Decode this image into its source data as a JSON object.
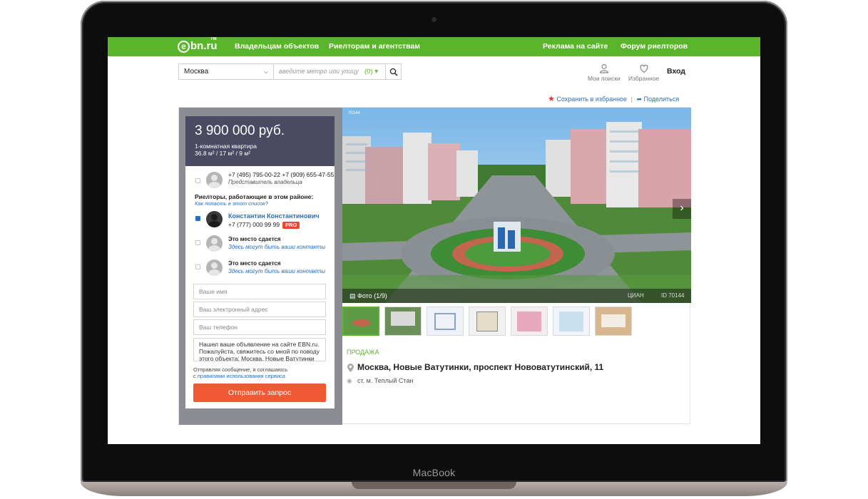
{
  "device": {
    "brand": "MacBook"
  },
  "nav": {
    "logo_text": "bn.ru",
    "logo_letter": "e",
    "logo_tm": "TM",
    "links": [
      "Владельцам объектов",
      "Риелторам и агентствам",
      "Реклама на сайте",
      "Форум риелторов"
    ]
  },
  "search": {
    "city": "Москва",
    "metro_placeholder": "введите метро или улицу",
    "metro_count": "(0)"
  },
  "header": {
    "my_searches": "Мои поиски",
    "favorites": "Избранное",
    "login": "Вход"
  },
  "actions": {
    "save": "Сохранить в избранное",
    "separator": "|",
    "share": "Поделиться"
  },
  "listing": {
    "price": "3 900 000 руб.",
    "type": "1-комнатная квартира",
    "area": "36.8 м² / 17 м² / 9 м²",
    "owner_phone": "+7 (495) 795-00-22 +7 (909) 655-47-55",
    "owner_role": "Представитель владельца",
    "realtors_title": "Риелторы, работающие в этом районе:",
    "realtors_link": "Как попасть в этот список?",
    "agent_name": "Константин Константинович",
    "agent_phone": "+7 (777) 000 99 99",
    "agent_badge": "PRO",
    "slot1_title": "Это место сдается",
    "slot1_link": "Здесь могут быть ваши контакты",
    "slot2_title": "Это место сдается",
    "slot2_link": "Здесь могут быть ваши контакты"
  },
  "form": {
    "name_placeholder": "Ваше имя",
    "email_placeholder": "Ваш электронный адрес",
    "phone_placeholder": "Ваш телефон",
    "message": "Нашел ваше объявление на сайте EBN.ru. Пожалуйста, свяжитесь со мной по поводу этого объекта: Москва, Новые Ватутинки",
    "agree_text": "Отправляя сообщение, я соглашаюсь",
    "agree_prefix": "с",
    "agree_link": "правилами использования сервиса",
    "submit": "Отправить запрос"
  },
  "photo": {
    "caption": "Фото (1/9)",
    "watermark_id": "ID 70144",
    "source": "ЦИАН",
    "top_id": "70144"
  },
  "details": {
    "status": "ПРОДАЖА",
    "address": "Москва, Новые Ватутинки, проспект Нововатутинский, 11",
    "metro": "ст. м. Теплый Стан"
  },
  "colors": {
    "brand_green": "#5bb52a",
    "price_bg": "#4a4b63",
    "submit": "#ef5a35",
    "link": "#2a6fbd"
  }
}
